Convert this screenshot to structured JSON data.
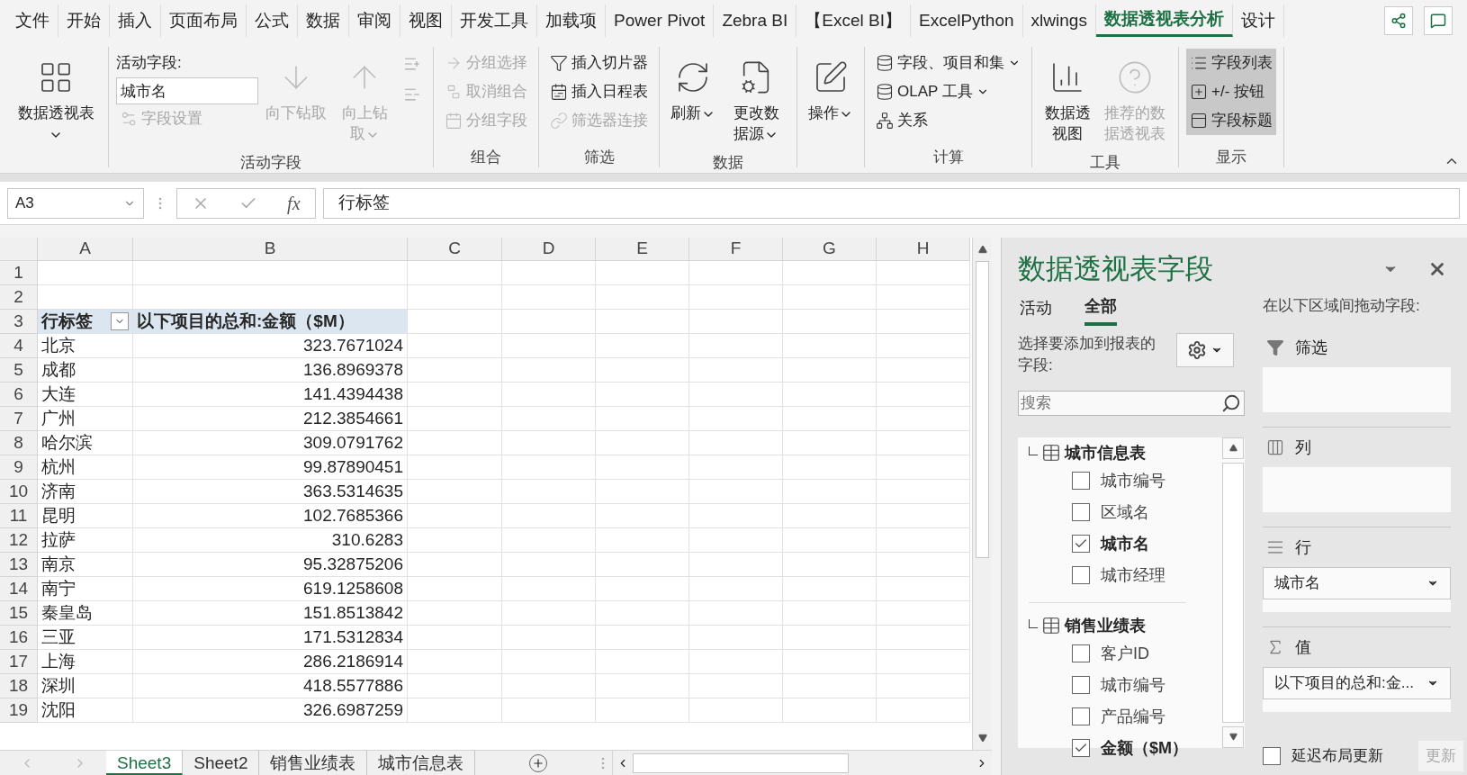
{
  "tabs": [
    {
      "label": "文件",
      "selected": false
    },
    {
      "label": "开始",
      "selected": false
    },
    {
      "label": "插入",
      "selected": false
    },
    {
      "label": "页面布局",
      "selected": false
    },
    {
      "label": "公式",
      "selected": false
    },
    {
      "label": "数据",
      "selected": false
    },
    {
      "label": "审阅",
      "selected": false
    },
    {
      "label": "视图",
      "selected": false
    },
    {
      "label": "开发工具",
      "selected": false
    },
    {
      "label": "加载项",
      "selected": false
    },
    {
      "label": "Power Pivot",
      "selected": false
    },
    {
      "label": "Zebra BI",
      "selected": false
    },
    {
      "label": "【Excel BI】",
      "selected": false
    },
    {
      "label": "ExcelPython",
      "selected": false
    },
    {
      "label": "xlwings",
      "selected": false
    },
    {
      "label": "数据透视表分析",
      "selected": true
    },
    {
      "label": "设计",
      "selected": false
    }
  ],
  "ribbon": {
    "groups": [
      {
        "columns": [
          [
            {
              "kind": "large",
              "label": "数据透视表",
              "dropdown": true,
              "disabled": false
            }
          ]
        ]
      },
      {
        "label": "活动字段",
        "columns": [
          [
            {
              "kind": "caption",
              "label": "活动字段:"
            },
            {
              "kind": "field",
              "value": "城市名"
            },
            {
              "kind": "small",
              "label": "字段设置",
              "disabled": true
            }
          ],
          [
            {
              "kind": "large",
              "label": "向下钻取",
              "disabled": true
            }
          ],
          [
            {
              "kind": "large",
              "label": "向上钻取",
              "dropdown": true,
              "disabled": true
            }
          ],
          [
            {
              "kind": "icon",
              "disabled": true
            },
            {
              "kind": "icon",
              "disabled": true
            }
          ]
        ]
      },
      {
        "label": "组合",
        "columns": [
          [
            {
              "kind": "small",
              "label": "分组选择",
              "disabled": true
            },
            {
              "kind": "small",
              "label": "取消组合",
              "disabled": true
            },
            {
              "kind": "small",
              "label": "分组字段",
              "disabled": true
            }
          ]
        ]
      },
      {
        "label": "筛选",
        "columns": [
          [
            {
              "kind": "small",
              "label": "插入切片器",
              "disabled": false
            },
            {
              "kind": "small",
              "label": "插入日程表",
              "disabled": false
            },
            {
              "kind": "small",
              "label": "筛选器连接",
              "disabled": true
            }
          ]
        ]
      },
      {
        "label": "数据",
        "columns": [
          [
            {
              "kind": "large",
              "label": "刷新",
              "dropdown": true,
              "disabled": false
            }
          ],
          [
            {
              "kind": "large",
              "label": "更改数据源",
              "dropdown": true,
              "disabled": false
            }
          ]
        ]
      },
      {
        "columns": [
          [
            {
              "kind": "large",
              "label": "操作",
              "dropdown": true,
              "disabled": false
            }
          ]
        ]
      },
      {
        "label": "计算",
        "columns": [
          [
            {
              "kind": "small",
              "label": "字段、项目和集",
              "dropdown": true,
              "disabled": false
            },
            {
              "kind": "small",
              "label": "OLAP 工具",
              "dropdown": true,
              "disabled": false
            },
            {
              "kind": "small",
              "label": "关系",
              "disabled": false
            }
          ]
        ]
      },
      {
        "label": "工具",
        "columns": [
          [
            {
              "kind": "large",
              "label": "数据透视图",
              "disabled": false
            }
          ],
          [
            {
              "kind": "large",
              "label": "推荐的数据透视表",
              "disabled": true
            }
          ]
        ]
      },
      {
        "label": "显示",
        "columns": [
          [
            {
              "kind": "small",
              "label": "字段列表",
              "on": true,
              "disabled": false
            },
            {
              "kind": "small",
              "label": "+/- 按钮",
              "on": true,
              "disabled": false
            },
            {
              "kind": "small",
              "label": "字段标题",
              "on": true,
              "disabled": false
            }
          ]
        ]
      }
    ]
  },
  "formula_bar": {
    "name_box": "A3",
    "function_label": "fx",
    "formula": "行标签"
  },
  "sheet": {
    "columns": [
      "A",
      "B",
      "C",
      "D",
      "E",
      "F",
      "G",
      "H"
    ],
    "header": {
      "row": "3",
      "label": "行标签",
      "value": "以下项目的总和:金额（$M）"
    },
    "empty_rows": [
      "1",
      "2"
    ],
    "rows": [
      {
        "row": "4",
        "label": "北京",
        "value": "323.7671024"
      },
      {
        "row": "5",
        "label": "成都",
        "value": "136.8969378"
      },
      {
        "row": "6",
        "label": "大连",
        "value": "141.4394438"
      },
      {
        "row": "7",
        "label": "广州",
        "value": "212.3854661"
      },
      {
        "row": "8",
        "label": "哈尔滨",
        "value": "309.0791762"
      },
      {
        "row": "9",
        "label": "杭州",
        "value": "99.87890451"
      },
      {
        "row": "10",
        "label": "济南",
        "value": "363.5314635"
      },
      {
        "row": "11",
        "label": "昆明",
        "value": "102.7685366"
      },
      {
        "row": "12",
        "label": "拉萨",
        "value": "310.6283"
      },
      {
        "row": "13",
        "label": "南京",
        "value": "95.32875206"
      },
      {
        "row": "14",
        "label": "南宁",
        "value": "619.1258608"
      },
      {
        "row": "15",
        "label": "秦皇岛",
        "value": "151.8513842"
      },
      {
        "row": "16",
        "label": "三亚",
        "value": "171.5312834"
      },
      {
        "row": "17",
        "label": "上海",
        "value": "286.2186914"
      },
      {
        "row": "18",
        "label": "深圳",
        "value": "418.5577886"
      },
      {
        "row": "19",
        "label": "沈阳",
        "value": "326.6987259"
      }
    ]
  },
  "sheet_tabs": [
    {
      "label": "Sheet3",
      "selected": true
    },
    {
      "label": "Sheet2",
      "selected": false
    },
    {
      "label": "销售业绩表",
      "selected": false
    },
    {
      "label": "城市信息表",
      "selected": false
    }
  ],
  "pane": {
    "title": "数据透视表字段",
    "tabs": [
      {
        "label": "活动",
        "selected": false
      },
      {
        "label": "全部",
        "selected": true
      }
    ],
    "instruction": "选择要添加到报表的字段:",
    "search_placeholder": "搜索",
    "tables": [
      {
        "name": "城市信息表",
        "fields": [
          {
            "label": "城市编号",
            "checked": false
          },
          {
            "label": "区域名",
            "checked": false
          },
          {
            "label": "城市名",
            "checked": true
          },
          {
            "label": "城市经理",
            "checked": false
          }
        ]
      },
      {
        "name": "销售业绩表",
        "fields": [
          {
            "label": "客户ID",
            "checked": false
          },
          {
            "label": "城市编号",
            "checked": false
          },
          {
            "label": "产品编号",
            "checked": false
          },
          {
            "label": "金额（$M）",
            "checked": true
          }
        ]
      }
    ],
    "areas_caption": "在以下区域间拖动字段:",
    "areas": [
      {
        "kind": "filter",
        "label": "筛选"
      },
      {
        "kind": "columns",
        "label": "列"
      },
      {
        "kind": "rows",
        "label": "行",
        "items": [
          "城市名"
        ]
      },
      {
        "kind": "values",
        "label": "值",
        "items": [
          "以下项目的总和:金..."
        ]
      }
    ],
    "defer": {
      "label": "延迟布局更新",
      "checked": false
    },
    "update_button": "更新"
  }
}
